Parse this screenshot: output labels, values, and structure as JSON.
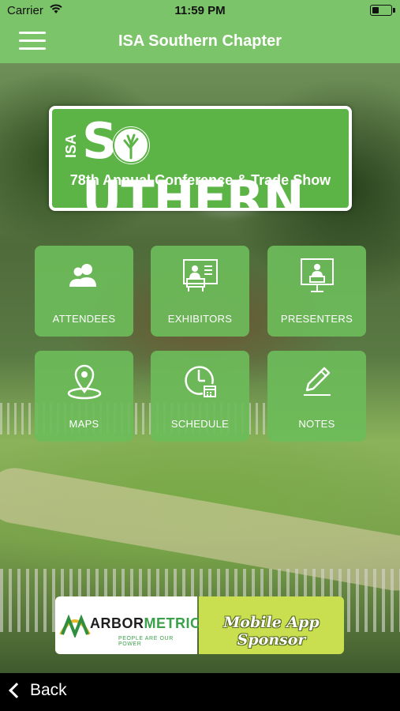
{
  "status_bar": {
    "carrier": "Carrier",
    "time": "11:59 PM"
  },
  "nav": {
    "title": "ISA Southern Chapter",
    "menu_icon": "hamburger-menu-icon"
  },
  "logo": {
    "isa": "ISA",
    "word": "S  UTHERN",
    "subtitle": "78th Annual Conference & Trade Show",
    "colors": {
      "background": "#5cb346",
      "border": "#ffffff"
    }
  },
  "tiles": [
    {
      "label": "ATTENDEES",
      "icon": "people-icon"
    },
    {
      "label": "EXHIBITORS",
      "icon": "exhibitor-booth-icon"
    },
    {
      "label": "PRESENTERS",
      "icon": "presenter-screen-icon"
    },
    {
      "label": "MAPS",
      "icon": "map-pin-icon"
    },
    {
      "label": "SCHEDULE",
      "icon": "clock-calendar-icon"
    },
    {
      "label": "NOTES",
      "icon": "pencil-icon"
    }
  ],
  "sponsor": {
    "brand_prefix": "ARBOR",
    "brand_suffix": "METRICS",
    "tagline": "PEOPLE ARE OUR POWER",
    "label": "Mobile App Sponsor"
  },
  "bottom_bar": {
    "back_label": "Back"
  },
  "colors": {
    "accent": "#7cc46a",
    "tile": "#6cbc5a",
    "sponsor_yellow": "#c9df4f"
  }
}
